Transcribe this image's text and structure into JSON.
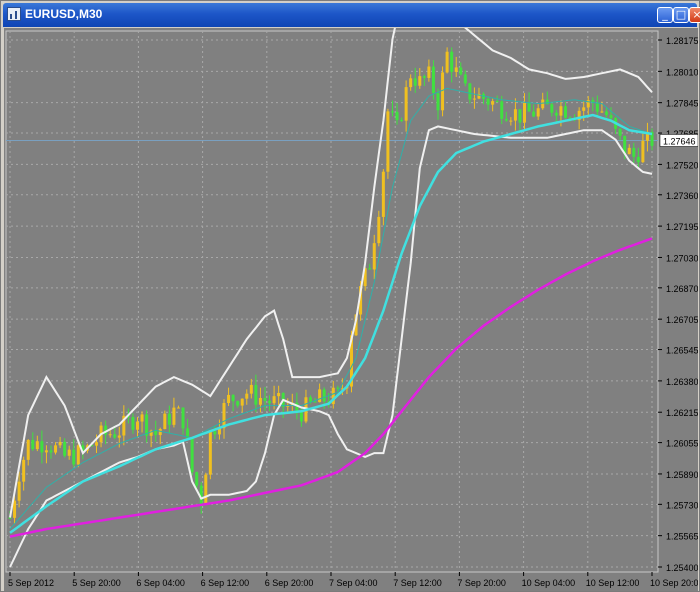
{
  "window": {
    "title": "EURUSD,M30",
    "buttons": {
      "minimize": "_",
      "maximize": "□",
      "close": "×"
    },
    "icon": "chart-window-icon"
  },
  "colors": {
    "background": "#808080",
    "grid": "#a8a8a8",
    "bull_candle": "#f0c020",
    "bear_candle": "#40e040",
    "bollinger": "#f0f0f0",
    "ma_fast": "#40e0e0",
    "ma_mid": "#30b0a8",
    "ma_slow": "#e020e0",
    "axis_text": "#000000",
    "price_line": "#7aa0c0"
  },
  "chart_data": {
    "type": "candlestick",
    "symbol": "EURUSD",
    "timeframe": "M30",
    "ylim": [
      1.254,
      1.28175
    ],
    "y_ticks": [
      "1.28175",
      "1.28010",
      "1.27845",
      "1.27685",
      "1.27520",
      "1.27360",
      "1.27195",
      "1.27030",
      "1.26870",
      "1.26705",
      "1.26545",
      "1.26380",
      "1.26215",
      "1.26055",
      "1.25890",
      "1.25730",
      "1.25565",
      "1.25400"
    ],
    "x_ticks": [
      "5 Sep 2012",
      "5 Sep 20:00",
      "6 Sep 04:00",
      "6 Sep 12:00",
      "6 Sep 20:00",
      "7 Sep 04:00",
      "7 Sep 12:00",
      "7 Sep 20:00",
      "10 Sep 04:00",
      "10 Sep 12:00",
      "10 Sep 20:00"
    ],
    "current_price": "1.27646",
    "grid": true,
    "close_path": [
      [
        0,
        1.2566
      ],
      [
        2,
        1.259
      ],
      [
        4,
        1.2605
      ],
      [
        8,
        1.2606
      ],
      [
        12,
        1.2598
      ],
      [
        16,
        1.26
      ],
      [
        20,
        1.2609
      ],
      [
        24,
        1.2612
      ],
      [
        28,
        1.262
      ],
      [
        32,
        1.261
      ],
      [
        36,
        1.2622
      ],
      [
        38,
        1.2618
      ],
      [
        40,
        1.259
      ],
      [
        42,
        1.2576
      ],
      [
        44,
        1.261
      ],
      [
        48,
        1.2628
      ],
      [
        52,
        1.2632
      ],
      [
        56,
        1.2628
      ],
      [
        60,
        1.2625
      ],
      [
        64,
        1.2622
      ],
      [
        68,
        1.2628
      ],
      [
        72,
        1.263
      ],
      [
        74,
        1.264
      ],
      [
        75,
        1.2665
      ],
      [
        77,
        1.2685
      ],
      [
        79,
        1.27
      ],
      [
        81,
        1.273
      ],
      [
        82,
        1.275
      ],
      [
        83,
        1.278
      ],
      [
        85,
        1.277
      ],
      [
        88,
        1.28
      ],
      [
        90,
        1.2795
      ],
      [
        92,
        1.2798
      ],
      [
        94,
        1.2785
      ],
      [
        96,
        1.281
      ],
      [
        98,
        1.28
      ],
      [
        100,
        1.279
      ],
      [
        104,
        1.2787
      ],
      [
        108,
        1.2782
      ],
      [
        112,
        1.2778
      ],
      [
        116,
        1.278
      ],
      [
        120,
        1.2783
      ],
      [
        124,
        1.278
      ],
      [
        128,
        1.2785
      ],
      [
        131,
        1.2778
      ],
      [
        133,
        1.2768
      ],
      [
        135,
        1.276
      ],
      [
        137,
        1.2756
      ],
      [
        139,
        1.2762
      ],
      [
        141,
        1.2765
      ]
    ],
    "bollinger_upper": [
      [
        0,
        1.2566
      ],
      [
        4,
        1.262
      ],
      [
        8,
        1.264
      ],
      [
        12,
        1.2625
      ],
      [
        16,
        1.26
      ],
      [
        20,
        1.261
      ],
      [
        24,
        1.2615
      ],
      [
        28,
        1.2625
      ],
      [
        32,
        1.2635
      ],
      [
        36,
        1.264
      ],
      [
        40,
        1.2636
      ],
      [
        44,
        1.263
      ],
      [
        48,
        1.2645
      ],
      [
        52,
        1.266
      ],
      [
        56,
        1.2672
      ],
      [
        58,
        1.2675
      ],
      [
        60,
        1.266
      ],
      [
        62,
        1.264
      ],
      [
        64,
        1.264
      ],
      [
        68,
        1.264
      ],
      [
        72,
        1.2642
      ],
      [
        74,
        1.265
      ],
      [
        76,
        1.267
      ],
      [
        78,
        1.27
      ],
      [
        80,
        1.274
      ],
      [
        82,
        1.2775
      ],
      [
        84,
        1.2818
      ],
      [
        86,
        1.284
      ],
      [
        88,
        1.284
      ],
      [
        90,
        1.284
      ],
      [
        94,
        1.2835
      ],
      [
        98,
        1.2828
      ],
      [
        102,
        1.282
      ],
      [
        106,
        1.2812
      ],
      [
        110,
        1.2808
      ],
      [
        114,
        1.2802
      ],
      [
        118,
        1.28
      ],
      [
        122,
        1.2797
      ],
      [
        126,
        1.2798
      ],
      [
        130,
        1.28
      ],
      [
        134,
        1.2802
      ],
      [
        138,
        1.2798
      ],
      [
        141,
        1.279
      ]
    ],
    "bollinger_lower": [
      [
        0,
        1.254
      ],
      [
        4,
        1.256
      ],
      [
        8,
        1.2575
      ],
      [
        12,
        1.258
      ],
      [
        16,
        1.2585
      ],
      [
        20,
        1.259
      ],
      [
        24,
        1.2595
      ],
      [
        28,
        1.2598
      ],
      [
        32,
        1.2602
      ],
      [
        36,
        1.2604
      ],
      [
        38,
        1.2606
      ],
      [
        40,
        1.2585
      ],
      [
        42,
        1.2576
      ],
      [
        44,
        1.2578
      ],
      [
        48,
        1.2578
      ],
      [
        52,
        1.258
      ],
      [
        54,
        1.2585
      ],
      [
        56,
        1.26
      ],
      [
        58,
        1.262
      ],
      [
        60,
        1.2628
      ],
      [
        64,
        1.2624
      ],
      [
        68,
        1.2622
      ],
      [
        70,
        1.262
      ],
      [
        72,
        1.261
      ],
      [
        74,
        1.2602
      ],
      [
        76,
        1.26
      ],
      [
        78,
        1.2598
      ],
      [
        80,
        1.26
      ],
      [
        82,
        1.26
      ],
      [
        84,
        1.262
      ],
      [
        86,
        1.266
      ],
      [
        88,
        1.27
      ],
      [
        90,
        1.275
      ],
      [
        92,
        1.277
      ],
      [
        94,
        1.2772
      ],
      [
        98,
        1.277
      ],
      [
        102,
        1.2768
      ],
      [
        106,
        1.2767
      ],
      [
        110,
        1.2766
      ],
      [
        114,
        1.2766
      ],
      [
        118,
        1.2766
      ],
      [
        122,
        1.2768
      ],
      [
        126,
        1.277
      ],
      [
        130,
        1.277
      ],
      [
        133,
        1.2765
      ],
      [
        136,
        1.2754
      ],
      [
        139,
        1.2748
      ],
      [
        141,
        1.2747
      ]
    ],
    "ma_fast": [
      [
        0,
        1.2558
      ],
      [
        8,
        1.2572
      ],
      [
        16,
        1.2585
      ],
      [
        24,
        1.2593
      ],
      [
        32,
        1.2602
      ],
      [
        40,
        1.2608
      ],
      [
        48,
        1.2615
      ],
      [
        56,
        1.262
      ],
      [
        64,
        1.2622
      ],
      [
        70,
        1.2626
      ],
      [
        74,
        1.2635
      ],
      [
        78,
        1.265
      ],
      [
        82,
        1.2675
      ],
      [
        86,
        1.2705
      ],
      [
        90,
        1.273
      ],
      [
        94,
        1.2748
      ],
      [
        98,
        1.2758
      ],
      [
        104,
        1.2764
      ],
      [
        110,
        1.2768
      ],
      [
        116,
        1.2772
      ],
      [
        122,
        1.2775
      ],
      [
        128,
        1.2778
      ],
      [
        132,
        1.2775
      ],
      [
        136,
        1.277
      ],
      [
        141,
        1.2768
      ]
    ],
    "ma_mid": [
      [
        0,
        1.256
      ],
      [
        8,
        1.2582
      ],
      [
        16,
        1.2595
      ],
      [
        24,
        1.2605
      ],
      [
        32,
        1.2612
      ],
      [
        40,
        1.2608
      ],
      [
        48,
        1.2618
      ],
      [
        56,
        1.2625
      ],
      [
        64,
        1.2625
      ],
      [
        72,
        1.2632
      ],
      [
        76,
        1.265
      ],
      [
        80,
        1.269
      ],
      [
        84,
        1.274
      ],
      [
        88,
        1.2775
      ],
      [
        92,
        1.2788
      ],
      [
        96,
        1.2792
      ],
      [
        100,
        1.279
      ],
      [
        108,
        1.2786
      ],
      [
        116,
        1.2784
      ],
      [
        124,
        1.2786
      ],
      [
        130,
        1.2784
      ],
      [
        136,
        1.2772
      ],
      [
        141,
        1.2768
      ]
    ],
    "ma_slow": [
      [
        0,
        1.2556
      ],
      [
        8,
        1.256
      ],
      [
        16,
        1.2563
      ],
      [
        24,
        1.2566
      ],
      [
        32,
        1.2569
      ],
      [
        40,
        1.2572
      ],
      [
        48,
        1.2575
      ],
      [
        56,
        1.2579
      ],
      [
        64,
        1.2583
      ],
      [
        72,
        1.259
      ],
      [
        78,
        1.26
      ],
      [
        82,
        1.261
      ],
      [
        86,
        1.2622
      ],
      [
        92,
        1.264
      ],
      [
        98,
        1.2655
      ],
      [
        104,
        1.2667
      ],
      [
        110,
        1.2677
      ],
      [
        116,
        1.2686
      ],
      [
        122,
        1.2694
      ],
      [
        128,
        1.2701
      ],
      [
        134,
        1.2707
      ],
      [
        141,
        1.2713
      ]
    ]
  }
}
